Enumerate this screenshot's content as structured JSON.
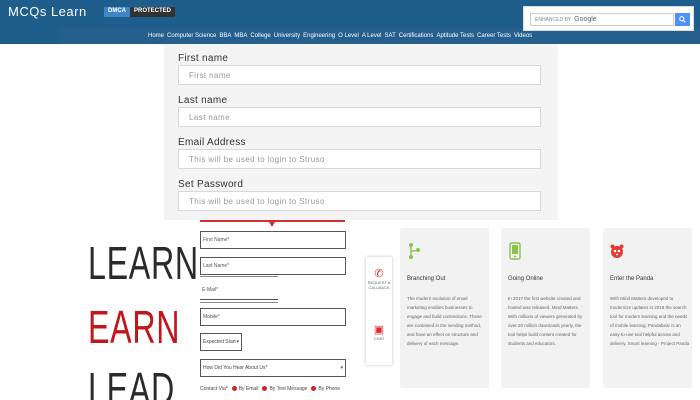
{
  "header": {
    "brand": "MCQs Learn",
    "dmca_left": "DMCA",
    "dmca_right": "PROTECTED",
    "search": {
      "enhanced_by": "ENHANCED BY",
      "google": "Google",
      "button_icon": "search-icon"
    },
    "nav": [
      "Home",
      "Computer Science",
      "BBA",
      "MBA",
      "College",
      "University",
      "Engineering",
      "O Level",
      "A Level",
      "SAT",
      "Certifications",
      "Aptitude Tests",
      "Career Tests",
      "Videos"
    ]
  },
  "signup_form": {
    "first_name": {
      "label": "First name",
      "placeholder": "First name"
    },
    "last_name": {
      "label": "Last name",
      "placeholder": "Last name"
    },
    "email": {
      "label": "Email Address",
      "placeholder": "This will be used to login to Struso"
    },
    "password": {
      "label": "Set Password",
      "placeholder": "This will be used to login to Struso"
    }
  },
  "slogan": {
    "line1": "LEARN",
    "line2": "EARN",
    "line3": "LEAD"
  },
  "contact_form": {
    "first_name": "First Name*",
    "last_name": "Last Name*",
    "email": "E-Mail*",
    "mobile": "Mobile*",
    "select": "Expected Start",
    "select_arrow": "▾",
    "how_heard": "How Did You Hear About Us*",
    "contact_via": "Contact Via*",
    "options": [
      "By Email",
      "By Text Message",
      "By Phone"
    ]
  },
  "side_widget": {
    "call_label": "REQUEST A CALLBACK",
    "chat_label": "CHAT"
  },
  "cards": [
    {
      "title": "Branching Out",
      "icon": "branch-icon",
      "color": "#8bc34a",
      "text": "The modern evolution of email marketing enables businesses to engage and build connections. These are contained in the sending method, and have an effect on structure and delivery of each message."
    },
    {
      "title": "Going Online",
      "icon": "mobile-icon",
      "color": "#8bc34a",
      "text": "In 2017 the first website created and hosted was released. Mind Matters. With millions of viewers generated by over 20 million downloads yearly, the tool helps build content created for students and educators."
    },
    {
      "title": "Enter the Panda",
      "icon": "panda-icon",
      "color": "#e53935",
      "text": "With Mind Matters developed to modernize updates in 2018 the search tool for modern learning and the needs of mobile learning, Pandabear is an easy-to-use tool helpful across and delivery. Smart learning - Project Panda"
    }
  ]
}
